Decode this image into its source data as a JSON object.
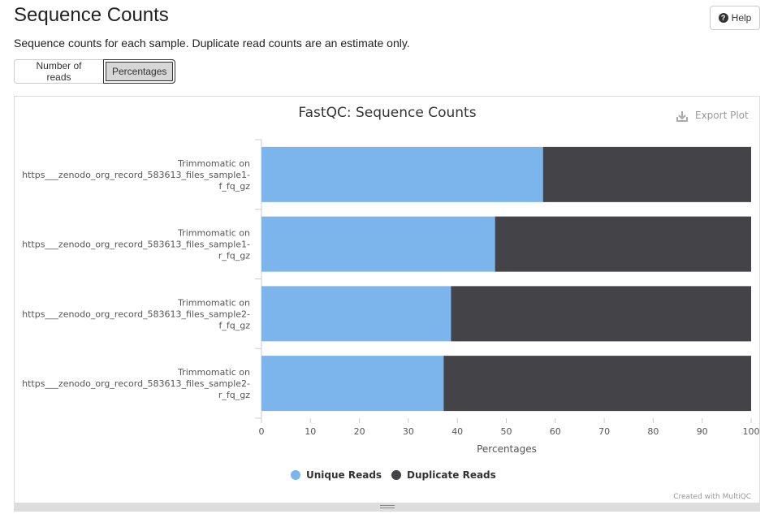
{
  "page": {
    "title": "Sequence Counts",
    "description": "Sequence counts for each sample. Duplicate read counts are an estimate only.",
    "help_label": "Help"
  },
  "toggle": {
    "options": [
      "Number of reads",
      "Percentages"
    ],
    "selected": "Percentages"
  },
  "plot": {
    "export_label": "Export Plot",
    "credit": "Created with MultiQC"
  },
  "chart_data": {
    "type": "bar",
    "orientation": "horizontal",
    "stacked": true,
    "title": "FastQC: Sequence Counts",
    "xlabel": "Percentages",
    "ylabel": "",
    "xlim": [
      0,
      100
    ],
    "xticks": [
      0,
      10,
      20,
      30,
      40,
      50,
      60,
      70,
      80,
      90,
      100
    ],
    "categories": [
      [
        "Trimmomatic on",
        "https___zenodo_org_record_583613_files_sample1-",
        "f_fq_gz"
      ],
      [
        "Trimmomatic on",
        "https___zenodo_org_record_583613_files_sample1-",
        "r_fq_gz"
      ],
      [
        "Trimmomatic on",
        "https___zenodo_org_record_583613_files_sample2-",
        "f_fq_gz"
      ],
      [
        "Trimmomatic on",
        "https___zenodo_org_record_583613_files_sample2-",
        "r_fq_gz"
      ]
    ],
    "series": [
      {
        "name": "Unique Reads",
        "color": "#7cb5ec",
        "values": [
          57.5,
          47.7,
          38.7,
          37.2
        ]
      },
      {
        "name": "Duplicate Reads",
        "color": "#434348",
        "values": [
          42.5,
          52.3,
          61.3,
          62.8
        ]
      }
    ],
    "legend_position": "bottom-center",
    "grid": false
  }
}
